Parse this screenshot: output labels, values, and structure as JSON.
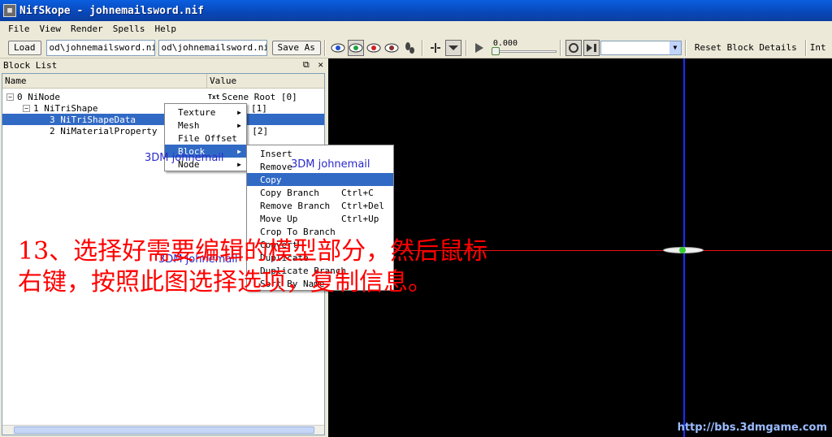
{
  "window": {
    "title": "NifSkope - johnemailsword.nif"
  },
  "menubar": [
    "File",
    "View",
    "Render",
    "Spells",
    "Help"
  ],
  "toolbar": {
    "load_label": "Load",
    "load_path": "od\\johnemailsword.nif",
    "save_path": "od\\johnemailsword.nif",
    "save_as_label": "Save As",
    "slider_value": "0.000",
    "reset_label": "Reset Block Details",
    "overflow_label": "Int"
  },
  "block_list": {
    "title": "Block List",
    "columns": [
      "Name",
      "Value"
    ],
    "rows": [
      {
        "name": "0 NiNode",
        "value": "Scene Root [0]"
      },
      {
        "name": "1 NiTriShape",
        "value": "[1]"
      },
      {
        "name": "3 NiTriShapeData",
        "value": ""
      },
      {
        "name": "2 NiMaterialProperty",
        "value": "t [2]"
      }
    ]
  },
  "context_menu": {
    "items": [
      "Texture",
      "Mesh",
      "File Offset",
      "Block",
      "Node"
    ]
  },
  "block_submenu": {
    "items": [
      {
        "label": "Insert",
        "shortcut": ""
      },
      {
        "label": "Remove",
        "shortcut": ""
      },
      {
        "label": "Copy",
        "shortcut": ""
      },
      {
        "label": "Copy Branch",
        "shortcut": "Ctrl+C"
      },
      {
        "label": "Remove Branch",
        "shortcut": "Ctrl+Del"
      },
      {
        "label": "Move Up",
        "shortcut": "Ctrl+Up"
      },
      {
        "label": "Crop To Branch",
        "shortcut": ""
      },
      {
        "label": "Convert",
        "shortcut": ""
      },
      {
        "label": "Duplicate",
        "shortcut": ""
      },
      {
        "label": "Duplicate Branch",
        "shortcut": ""
      },
      {
        "label": "Sort By Name",
        "shortcut": ""
      }
    ]
  },
  "watermarks": [
    "3DM johnemail",
    "3DM johnemail",
    "3DM johnemail"
  ],
  "instruction": {
    "line1": "13、选择好需要编辑的模型部分，然后鼠标",
    "line2": "右键，按照此图选择选项，复制信息。"
  },
  "site_mark": "http://bbs.3dmgame.com"
}
